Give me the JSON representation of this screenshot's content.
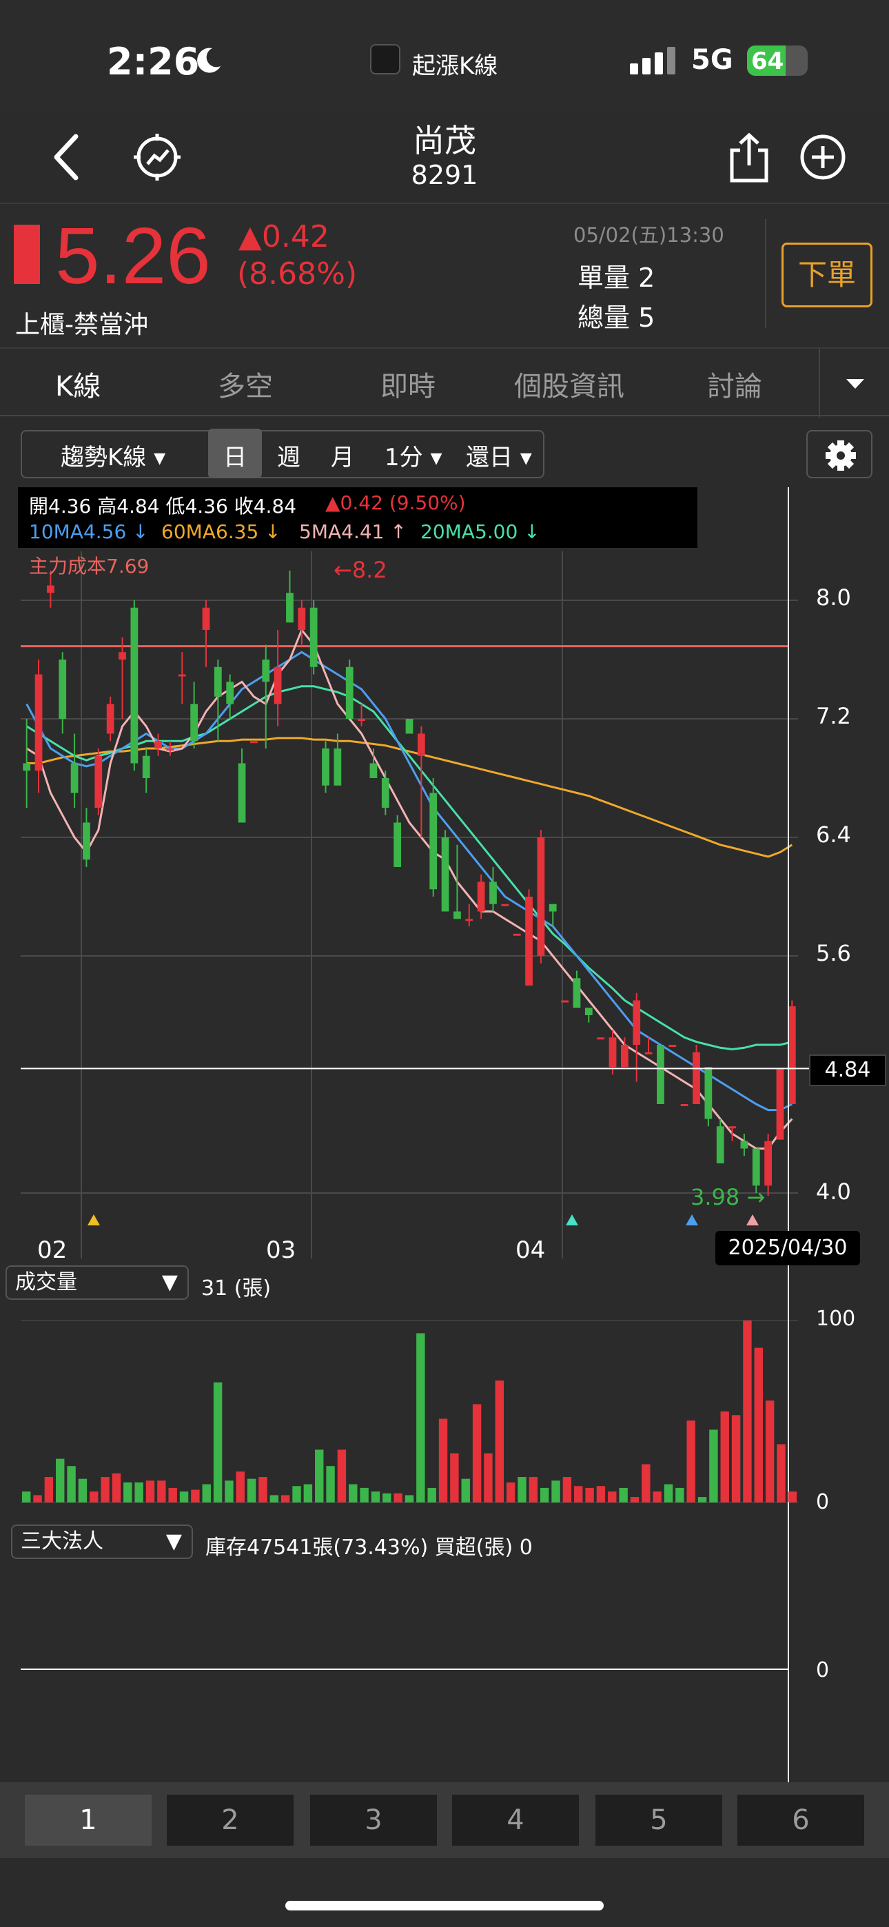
{
  "status": {
    "time": "2:26",
    "app_name": "起漲K線",
    "network": "5G",
    "battery": "64",
    "battery_level": 0.64
  },
  "nav": {
    "title": "尚茂",
    "code": "8291"
  },
  "quote": {
    "price": "5.26",
    "change": "▲0.42",
    "change_pct": "(8.68%)",
    "market": "上櫃-禁當沖",
    "datetime": "05/02(五)13:30",
    "single_vol": "單量 2",
    "total_vol": "總量 5",
    "order_label": "下單"
  },
  "tabs": [
    "K線",
    "多空",
    "即時",
    "個股資訊",
    "討論"
  ],
  "toolbar": {
    "kline_type": "趨勢K線 ▾",
    "day": "日",
    "week": "週",
    "month": "月",
    "minute": "1分 ▾",
    "restore": "還日 ▾"
  },
  "legend": {
    "ohlc": "開4.36  高4.84  低4.36  收4.84",
    "chg": "▲0.42 (9.50%)",
    "ma10": "10MA4.56 ↓",
    "ma60": "60MA6.35 ↓",
    "ma5": "5MA4.41 ↑",
    "ma20": "20MA5.00 ↓",
    "cost": "主力成本7.69",
    "high_mark": "←8.2",
    "low_mark": "3.98 →"
  },
  "colors": {
    "up": "#e6323a",
    "down": "#3cb54a",
    "ma5": "#f2b3b3",
    "ma10": "#4d9ef0",
    "ma20": "#47e0a8",
    "ma60": "#f0a82a",
    "cost": "#e8645e"
  },
  "price_chart": {
    "yticks": [
      "8.0",
      "7.2",
      "6.4",
      "5.6",
      "4.0"
    ],
    "current_price": "4.84",
    "xlabels": [
      "02",
      "03",
      "04"
    ],
    "last_date": "2025/04/30"
  },
  "volume": {
    "selector": "成交量",
    "value": "31 (張)",
    "ticks": [
      "100",
      "0"
    ]
  },
  "institutional": {
    "selector": "三大法人",
    "info": "庫存47541張(73.43%)  買超(張) 0",
    "tick": "0"
  },
  "pager": [
    "1",
    "2",
    "3",
    "4",
    "5",
    "6"
  ],
  "chart_data": {
    "type": "candlestick",
    "ylim": [
      3.8,
      8.4
    ],
    "main_cost": 7.69,
    "current": 4.84,
    "candles": [
      [
        6.9,
        6.85,
        7.2,
        6.6
      ],
      [
        6.85,
        7.5,
        7.6,
        6.7
      ],
      [
        8.05,
        8.1,
        8.2,
        7.95
      ],
      [
        7.6,
        7.2,
        7.65,
        7.1
      ],
      [
        6.9,
        6.7,
        7.1,
        6.6
      ],
      [
        6.5,
        6.25,
        6.6,
        6.2
      ],
      [
        6.6,
        6.95,
        7.0,
        6.55
      ],
      [
        7.1,
        7.3,
        7.35,
        7.05
      ],
      [
        7.6,
        7.65,
        7.75,
        7.2
      ],
      [
        7.95,
        6.9,
        8.0,
        6.85
      ],
      [
        6.95,
        6.8,
        7.0,
        6.7
      ],
      [
        7.0,
        7.05,
        7.1,
        6.95
      ],
      [
        7.0,
        7.0,
        7.05,
        6.95
      ],
      [
        7.5,
        7.5,
        7.65,
        7.3
      ],
      [
        7.3,
        7.05,
        7.45,
        7.0
      ],
      [
        7.8,
        7.95,
        8.0,
        7.55
      ],
      [
        7.55,
        7.35,
        7.6,
        7.05
      ],
      [
        7.45,
        7.3,
        7.5,
        7.2
      ],
      [
        6.9,
        6.5,
        7.0,
        6.5
      ],
      [
        7.05,
        7.05,
        7.05,
        7.05
      ],
      [
        7.6,
        7.45,
        7.7,
        7.0
      ],
      [
        7.3,
        7.55,
        7.8,
        7.15
      ],
      [
        8.05,
        7.85,
        8.2,
        7.95
      ],
      [
        7.8,
        7.95,
        8.0,
        7.7
      ],
      [
        7.95,
        7.55,
        8.0,
        7.5
      ],
      [
        7.0,
        6.75,
        7.05,
        6.7
      ],
      [
        7.0,
        6.75,
        7.1,
        6.75
      ],
      [
        7.55,
        7.2,
        7.6,
        7.2
      ],
      [
        7.2,
        7.2,
        7.3,
        7.15
      ],
      [
        6.9,
        6.8,
        7.0,
        6.8
      ],
      [
        6.8,
        6.6,
        6.85,
        6.55
      ],
      [
        6.5,
        6.2,
        6.55,
        6.2
      ],
      [
        7.2,
        7.1,
        7.2,
        7.1
      ],
      [
        6.95,
        7.1,
        7.15,
        6.4
      ],
      [
        6.7,
        6.05,
        6.8,
        6.0
      ],
      [
        6.4,
        5.9,
        6.45,
        5.95
      ],
      [
        5.9,
        5.85,
        6.35,
        5.85
      ],
      [
        5.85,
        5.85,
        5.95,
        5.8
      ],
      [
        5.9,
        6.1,
        6.15,
        5.85
      ],
      [
        6.1,
        5.95,
        6.2,
        5.9
      ],
      [
        5.95,
        5.95,
        5.95,
        5.95
      ],
      [
        5.75,
        5.75,
        5.75,
        5.75
      ],
      [
        5.4,
        6.0,
        6.05,
        5.4
      ],
      [
        5.6,
        6.4,
        6.45,
        5.55
      ],
      [
        5.95,
        5.9,
        5.95,
        5.8
      ],
      [
        5.3,
        5.3,
        5.3,
        5.3
      ],
      [
        5.45,
        5.25,
        5.5,
        5.25
      ],
      [
        5.25,
        5.2,
        5.25,
        5.15
      ],
      [
        5.05,
        5.05,
        5.05,
        5.05
      ],
      [
        4.85,
        5.05,
        5.1,
        4.8
      ],
      [
        4.85,
        5.0,
        5.05,
        4.85
      ],
      [
        5.0,
        5.3,
        5.35,
        4.75
      ],
      [
        4.95,
        4.95,
        5.05,
        4.95
      ],
      [
        5.0,
        4.6,
        5.0,
        4.6
      ],
      [
        5.0,
        5.0,
        5.0,
        5.0
      ],
      [
        4.6,
        4.6,
        4.6,
        4.6
      ],
      [
        4.6,
        4.95,
        5.0,
        4.6
      ],
      [
        4.85,
        4.5,
        4.85,
        4.45
      ],
      [
        4.45,
        4.2,
        4.5,
        4.2
      ],
      [
        4.45,
        4.45,
        4.45,
        4.35
      ],
      [
        4.35,
        4.3,
        4.4,
        4.25
      ],
      [
        4.3,
        4.05,
        4.3,
        4.0
      ],
      [
        4.05,
        4.35,
        4.4,
        3.98
      ],
      [
        4.36,
        4.84,
        4.84,
        4.36
      ],
      [
        4.6,
        5.26,
        5.3,
        4.6
      ]
    ],
    "volume": [
      6,
      4,
      14,
      24,
      20,
      13,
      6,
      14,
      16,
      11,
      11,
      12,
      12,
      8,
      6,
      7,
      10,
      66,
      12,
      17,
      13,
      14,
      4,
      4,
      9,
      10,
      29,
      20,
      29,
      10,
      8,
      6,
      5,
      5,
      4,
      93,
      8,
      46,
      27,
      13,
      54,
      27,
      67,
      11,
      14,
      14,
      8,
      12,
      14,
      9,
      8,
      9,
      6,
      8,
      3,
      21,
      6,
      10,
      8,
      45,
      3,
      40,
      50,
      48,
      100,
      85,
      56,
      32,
      6
    ],
    "ma5": [
      7.0,
      6.95,
      6.7,
      6.55,
      6.4,
      6.3,
      6.45,
      6.9,
      7.15,
      7.25,
      7.15,
      7.0,
      6.98,
      7.0,
      7.1,
      7.25,
      7.35,
      7.4,
      7.45,
      7.35,
      7.3,
      7.5,
      7.6,
      7.8,
      7.7,
      7.5,
      7.3,
      7.2,
      7.1,
      6.95,
      6.8,
      6.65,
      6.5,
      6.4,
      6.3,
      6.25,
      6.1,
      6.0,
      5.9,
      5.9,
      5.85,
      5.8,
      5.75,
      5.7,
      5.6,
      5.5,
      5.4,
      5.3,
      5.2,
      5.1,
      5.0,
      4.95,
      4.9,
      4.85,
      4.8,
      4.75,
      4.7,
      4.6,
      4.5,
      4.4,
      4.35,
      4.3,
      4.3,
      4.41,
      4.5
    ],
    "ma10": [
      7.3,
      7.15,
      7.0,
      6.95,
      6.9,
      6.88,
      6.9,
      6.95,
      7.0,
      7.05,
      7.1,
      7.05,
      7.0,
      7.0,
      7.05,
      7.1,
      7.2,
      7.3,
      7.4,
      7.45,
      7.5,
      7.55,
      7.6,
      7.65,
      7.6,
      7.55,
      7.5,
      7.45,
      7.4,
      7.3,
      7.2,
      7.05,
      6.9,
      6.75,
      6.6,
      6.5,
      6.4,
      6.3,
      6.2,
      6.1,
      6.0,
      5.95,
      5.9,
      5.85,
      5.8,
      5.7,
      5.6,
      5.5,
      5.4,
      5.3,
      5.2,
      5.1,
      5.05,
      5.0,
      4.95,
      4.9,
      4.85,
      4.8,
      4.75,
      4.7,
      4.65,
      4.6,
      4.56,
      4.56,
      4.6
    ],
    "ma20": [
      7.15,
      7.1,
      7.05,
      7.0,
      6.95,
      6.92,
      6.95,
      6.97,
      7.0,
      7.02,
      7.05,
      7.05,
      7.05,
      7.05,
      7.08,
      7.1,
      7.15,
      7.2,
      7.25,
      7.3,
      7.35,
      7.38,
      7.4,
      7.42,
      7.42,
      7.4,
      7.38,
      7.35,
      7.3,
      7.25,
      7.15,
      7.05,
      6.95,
      6.85,
      6.75,
      6.65,
      6.55,
      6.45,
      6.35,
      6.25,
      6.15,
      6.05,
      5.95,
      5.85,
      5.75,
      5.68,
      5.6,
      5.52,
      5.45,
      5.38,
      5.3,
      5.25,
      5.2,
      5.15,
      5.1,
      5.05,
      5.02,
      5.0,
      4.98,
      4.97,
      4.98,
      5.0,
      5.0,
      5.0,
      5.02
    ],
    "ma60": [
      6.9,
      6.9,
      6.92,
      6.94,
      6.95,
      6.96,
      6.97,
      6.98,
      6.98,
      6.99,
      7.0,
      7.0,
      7.01,
      7.02,
      7.03,
      7.04,
      7.05,
      7.05,
      7.06,
      7.06,
      7.06,
      7.07,
      7.07,
      7.07,
      7.06,
      7.06,
      7.05,
      7.05,
      7.04,
      7.03,
      7.02,
      7.0,
      6.98,
      6.96,
      6.94,
      6.92,
      6.9,
      6.88,
      6.86,
      6.84,
      6.82,
      6.8,
      6.78,
      6.76,
      6.74,
      6.72,
      6.7,
      6.68,
      6.65,
      6.62,
      6.59,
      6.56,
      6.53,
      6.5,
      6.47,
      6.44,
      6.41,
      6.38,
      6.35,
      6.33,
      6.31,
      6.29,
      6.27,
      6.3,
      6.35
    ]
  }
}
